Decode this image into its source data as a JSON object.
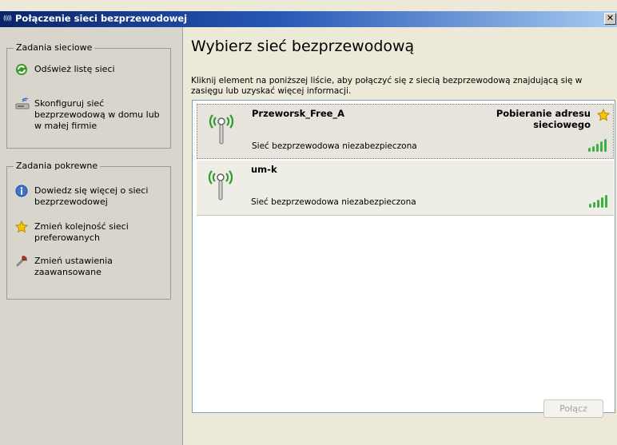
{
  "window": {
    "title": "Połączenie sieci bezprzewodowej",
    "title_icon": "((ı))",
    "close_glyph": "✕"
  },
  "left_pane": {
    "network_tasks": {
      "caption": "Zadania sieciowe",
      "items": [
        {
          "label": "Odśwież listę sieci",
          "icon": "refresh-icon"
        },
        {
          "label": "Skonfiguruj sieć bezprzewodową w domu lub w małej firmie",
          "icon": "setup-wizard-icon"
        }
      ]
    },
    "related_tasks": {
      "caption": "Zadania pokrewne",
      "items": [
        {
          "label": "Dowiedz się więcej o sieci bezprzewodowej",
          "icon": "info-icon"
        },
        {
          "label": "Zmień kolejność sieci preferowanych",
          "icon": "star-icon"
        },
        {
          "label": "Zmień ustawienia zaawansowane",
          "icon": "settings-icon"
        }
      ]
    }
  },
  "main": {
    "heading": "Wybierz sieć bezprzewodową",
    "instructions": "Kliknij element na poniższej liście, aby połączyć się z siecią bezprzewodową znajdującą się w zasięgu lub uzyskać więcej informacji.",
    "networks": [
      {
        "name": "Przeworsk_Free_A",
        "status": "Pobieranie adresu sieciowego",
        "security": "Sieć bezprzewodowa niezabezpieczona",
        "signal_bars": 5,
        "preferred": true,
        "selected": true
      },
      {
        "name": "um-k",
        "status": "",
        "security": "Sieć bezprzewodowa niezabezpieczona",
        "signal_bars": 5,
        "preferred": false,
        "selected": false
      }
    ],
    "connect_button": "Połącz"
  },
  "colors": {
    "titlebar_start": "#0a246a",
    "titlebar_end": "#a6caf0",
    "signal_green": "#3cb043",
    "star_yellow": "#f5c400"
  }
}
